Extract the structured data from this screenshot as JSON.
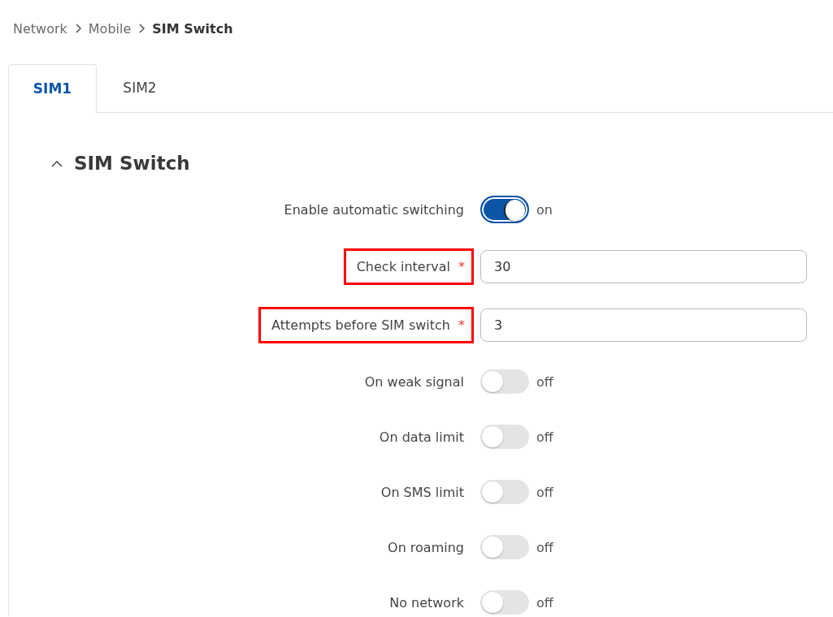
{
  "breadcrumb": [
    {
      "label": "Network",
      "current": false
    },
    {
      "label": "Mobile",
      "current": false
    },
    {
      "label": "SIM Switch",
      "current": true
    }
  ],
  "tabs": [
    {
      "label": "SIM1",
      "selected": true
    },
    {
      "label": "SIM2",
      "selected": false
    }
  ],
  "section": {
    "title": "SIM Switch",
    "expanded": true
  },
  "fields": [
    {
      "kind": "toggle",
      "label": "Enable automatic switching",
      "on": true,
      "state_text": "on"
    },
    {
      "kind": "input",
      "label": "Check interval",
      "required_mark": "*",
      "value": "30",
      "highlighted": true
    },
    {
      "kind": "input",
      "label": "Attempts before SIM switch",
      "required_mark": "*",
      "value": "3",
      "highlighted": true
    },
    {
      "kind": "toggle",
      "label": "On weak signal",
      "on": false,
      "state_text": "off"
    },
    {
      "kind": "toggle",
      "label": "On data limit",
      "on": false,
      "state_text": "off"
    },
    {
      "kind": "toggle",
      "label": "On SMS limit",
      "on": false,
      "state_text": "off"
    },
    {
      "kind": "toggle",
      "label": "On roaming",
      "on": false,
      "state_text": "off"
    },
    {
      "kind": "toggle",
      "label": "No network",
      "on": false,
      "state_text": "off"
    }
  ]
}
